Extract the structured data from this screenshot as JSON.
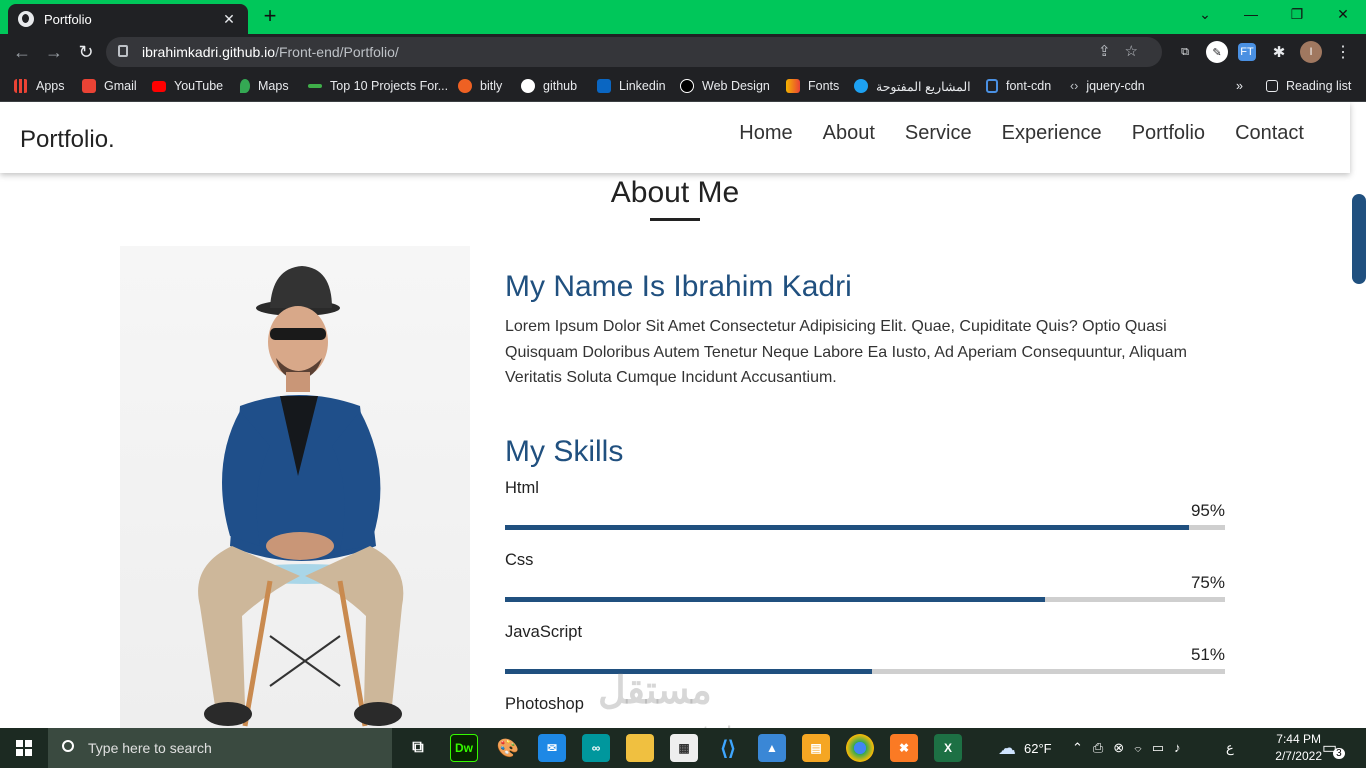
{
  "browser": {
    "tab_title": "Portfolio",
    "new_tab": "+",
    "close_tab": "✕",
    "url_host": "ibrahimkadri.github.io",
    "url_path": "/Front-end/Portfolio/",
    "profile_initial": "I",
    "ext_label": "FT"
  },
  "bookmarks": [
    {
      "label": "Apps",
      "color": "#ea4335"
    },
    {
      "label": "Gmail",
      "color": "#ea4335"
    },
    {
      "label": "YouTube",
      "color": "#ff0000"
    },
    {
      "label": "Maps",
      "color": "#34a853"
    },
    {
      "label": "Top 10 Projects For...",
      "color": "#3fae49"
    },
    {
      "label": "bitly",
      "color": "#ee6123"
    },
    {
      "label": "github",
      "color": "#ffffff"
    },
    {
      "label": "Linkedin",
      "color": "#0a66c2"
    },
    {
      "label": "Web Design",
      "color": "#ffffff"
    },
    {
      "label": "Fonts",
      "color": "#f4b400"
    },
    {
      "label": "المشاريع المفتوحة",
      "color": "#1da1f2"
    },
    {
      "label": "font-cdn",
      "color": "#4a90e2"
    },
    {
      "label": "jquery-cdn",
      "color": "#bdc1c6"
    }
  ],
  "bookmarks_overflow": "»",
  "reading_list": "Reading list",
  "site": {
    "logo": "Portfolio.",
    "menu": [
      "Home",
      "About",
      "Service",
      "Experience",
      "Portfolio",
      "Contact"
    ],
    "section_title": "About Me",
    "name_heading": "My Name Is Ibrahim Kadri",
    "bio": "Lorem Ipsum Dolor Sit Amet Consectetur Adipisicing Elit. Quae, Cupiditate Quis? Optio Quasi Quisquam Doloribus Autem Tenetur Neque Labore Ea Iusto, Ad Aperiam Consequuntur, Aliquam Veritatis Soluta Cumque Incidunt Accusantium.",
    "skills_heading": "My Skills",
    "skills": [
      {
        "name": "Html",
        "percent_label": "95%",
        "value": 95
      },
      {
        "name": "Css",
        "percent_label": "75%",
        "value": 75
      },
      {
        "name": "JavaScript",
        "percent_label": "51%",
        "value": 51
      },
      {
        "name": "Photoshop",
        "percent_label": "",
        "value": 0
      }
    ]
  },
  "watermark": {
    "main": "مستقل",
    "sub": "mostaql.com"
  },
  "taskbar": {
    "search_placeholder": "Type here to search",
    "weather": "62°F",
    "time": "7:44 PM",
    "date": "2/7/2022",
    "notification_count": "3",
    "lang": "ع"
  },
  "colors": {
    "accent": "#20507f",
    "tabbar": "#00c75a",
    "chrome": "#202124"
  }
}
